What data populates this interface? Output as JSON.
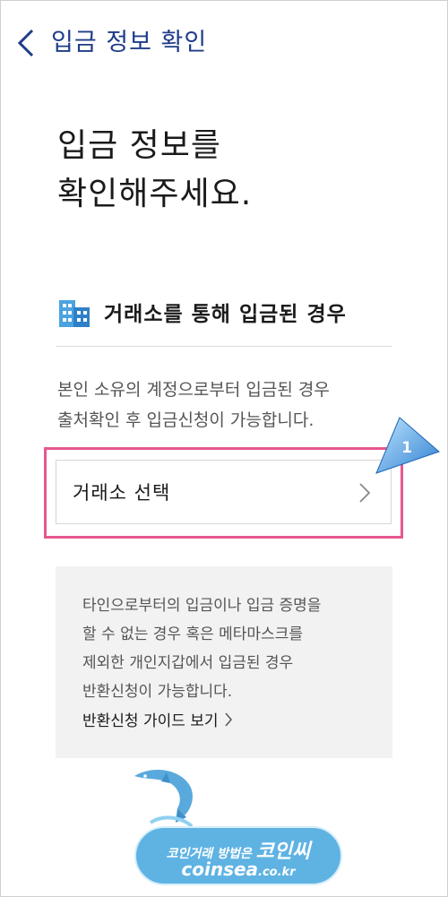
{
  "header": {
    "title": "입금 정보 확인"
  },
  "headline": {
    "line1": "입금 정보를",
    "line2": "확인해주세요."
  },
  "section": {
    "title": "거래소를 통해 입금된 경우",
    "desc_line1": "본인 소유의 계정으로부터 입금된 경우",
    "desc_line2": "출처확인 후 입금신청이 가능합니다."
  },
  "select": {
    "label": "거래소 선택"
  },
  "callout": {
    "number": "1"
  },
  "notice": {
    "line1": "타인으로부터의 입금이나 입금 증명을",
    "line2": "할 수 없는 경우 혹은 메타마스크를",
    "line3": "제외한 개인지갑에서 입금된 경우",
    "line4": "반환신청이 가능합니다.",
    "guide_link": "반환신청 가이드 보기"
  },
  "watermark": {
    "line1_prefix": "코인거래 방법은",
    "line1_brand": "코인씨",
    "line2_main": "coinsea",
    "line2_suffix": ".co.kr"
  },
  "colors": {
    "header_title": "#1f3c88",
    "highlight": "#e6578e",
    "callout": "#3a8fd8"
  },
  "icons": [
    "chevron-left-icon",
    "building-icon",
    "chevron-right-icon",
    "dolphin-icon"
  ]
}
